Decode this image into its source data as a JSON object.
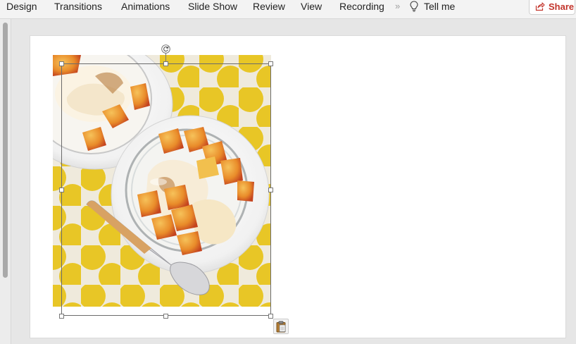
{
  "ribbon": {
    "tabs": [
      {
        "label": "Design"
      },
      {
        "label": "Transitions"
      },
      {
        "label": "Animations"
      },
      {
        "label": "Slide Show"
      },
      {
        "label": "Review"
      },
      {
        "label": "View"
      },
      {
        "label": "Recording"
      }
    ],
    "overflow_label": "»",
    "tell_me_label": "Tell me",
    "share_label": "Share"
  },
  "colors": {
    "share_accent": "#c2342b",
    "selection_border": "#6b6b6b",
    "polka_dot": "#e8c41c"
  },
  "icons": {
    "tell_me": "lightbulb-icon",
    "share": "share-icon",
    "rotate": "rotate-icon",
    "paste_options": "clipboard-icon"
  }
}
